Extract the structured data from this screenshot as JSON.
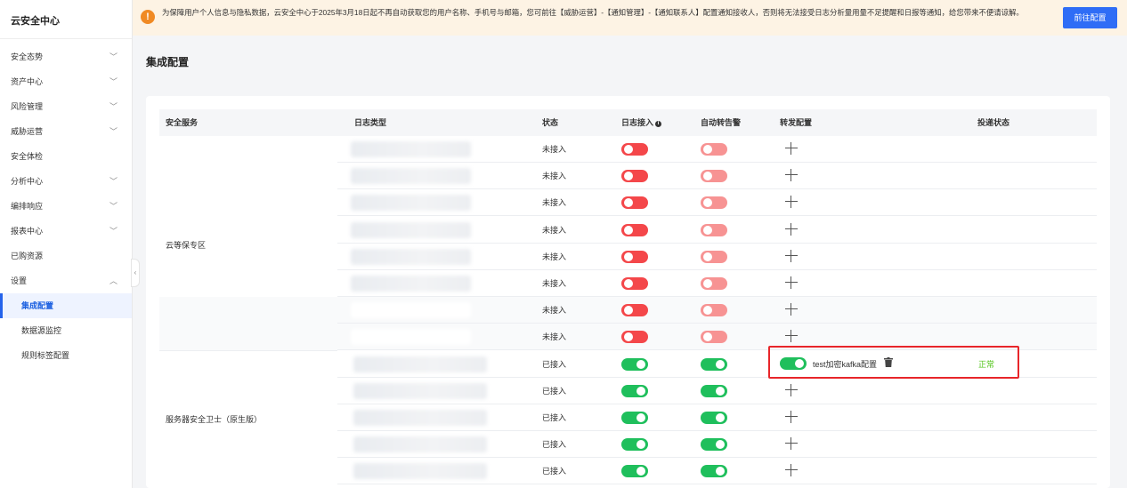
{
  "app": {
    "title": "云安全中心"
  },
  "sidebar": {
    "items": [
      {
        "label": "安全态势",
        "expandable": true
      },
      {
        "label": "资产中心",
        "expandable": true
      },
      {
        "label": "风险管理",
        "expandable": true
      },
      {
        "label": "威胁运营",
        "expandable": true
      },
      {
        "label": "安全体检",
        "expandable": false
      },
      {
        "label": "分析中心",
        "expandable": true
      },
      {
        "label": "编排响应",
        "expandable": true
      },
      {
        "label": "报表中心",
        "expandable": true
      },
      {
        "label": "已购资源",
        "expandable": false
      },
      {
        "label": "设置",
        "expandable": true,
        "expanded": true
      }
    ],
    "sub_items": [
      {
        "label": "集成配置",
        "active": true
      },
      {
        "label": "数据源监控",
        "active": false
      },
      {
        "label": "规则标签配置",
        "active": false
      }
    ]
  },
  "notice": {
    "icon": "warning-icon",
    "text": "为保障用户个人信息与隐私数据，云安全中心于2025年3月18日起不再自动获取您的用户名称、手机号与邮箱，您可前往【威胁运营】-【通知管理】-【通知联系人】配置通知接收人，否则将无法接受日志分析量用量不足提醒和日报等通知，给您带来不便请谅解。",
    "button": "前往配置"
  },
  "page": {
    "title": "集成配置"
  },
  "table": {
    "headers": [
      "安全服务",
      "日志类型",
      "状态",
      "日志接入",
      "自动转告警",
      "转发配置",
      "投递状态"
    ],
    "groups": [
      {
        "service": "云等保专区",
        "first_row": 0,
        "row_count": 8
      },
      {
        "service": "服务器安全卫士（原生版）",
        "first_row": 8,
        "row_count": 5
      }
    ],
    "rows": [
      {
        "status": "未接入",
        "log_access": false,
        "auto_alert": false
      },
      {
        "status": "未接入",
        "log_access": false,
        "auto_alert": false
      },
      {
        "status": "未接入",
        "log_access": false,
        "auto_alert": false
      },
      {
        "status": "未接入",
        "log_access": false,
        "auto_alert": false
      },
      {
        "status": "未接入",
        "log_access": false,
        "auto_alert": false
      },
      {
        "status": "未接入",
        "log_access": false,
        "auto_alert": false
      },
      {
        "status": "未接入",
        "log_access": false,
        "auto_alert": false
      },
      {
        "status": "未接入",
        "log_access": false,
        "auto_alert": false
      },
      {
        "status": "已接入",
        "log_access": true,
        "auto_alert": true,
        "forward": {
          "enabled": true,
          "name": "test加密kafka配置",
          "delivery_status": "正常"
        }
      },
      {
        "status": "已接入",
        "log_access": true,
        "auto_alert": true
      },
      {
        "status": "已接入",
        "log_access": true,
        "auto_alert": true
      },
      {
        "status": "已接入",
        "log_access": true,
        "auto_alert": true
      },
      {
        "status": "已接入",
        "log_access": true,
        "auto_alert": true
      }
    ]
  },
  "colors": {
    "toggle_off_access": "#f4474a",
    "toggle_off_alert": "#f79393",
    "toggle_on": "#1fbf5c",
    "primary": "#2f6df6",
    "ok": "#52c41a",
    "highlight_border": "#e8262a"
  }
}
